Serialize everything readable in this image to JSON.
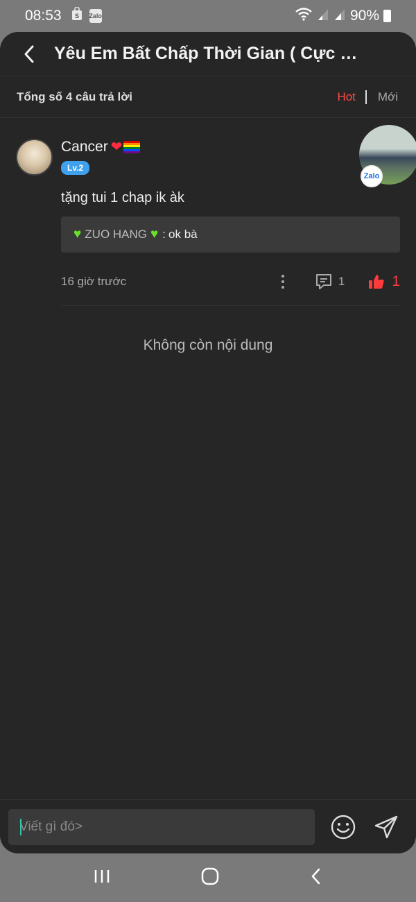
{
  "status_bar": {
    "time": "08:53",
    "app_icon_label": "Zalo",
    "battery": "90%"
  },
  "header": {
    "title": "Yêu Em Bất Chấp Thời Gian ( Cực Hà..."
  },
  "subheader": {
    "total": "Tổng số 4 câu trả lời",
    "tab_hot": "Hot",
    "tab_new": "Mới"
  },
  "comment": {
    "username": "Cancer",
    "level": "Lv.2",
    "text": "tặng tui 1 chap ik àk",
    "zalo_badge": "Zalo",
    "reply": {
      "author": "ZUO HANG",
      "separator": ":",
      "text": "ok bà"
    },
    "time_ago": "16 giờ trước",
    "reply_count": "1",
    "like_count": "1"
  },
  "empty_message": "Không còn nội dung",
  "input": {
    "placeholder": "Viết gì đó>"
  },
  "colors": {
    "accent_red": "#ff4b4b",
    "level_blue": "#3fa1ee",
    "panel_bg": "#262626"
  }
}
